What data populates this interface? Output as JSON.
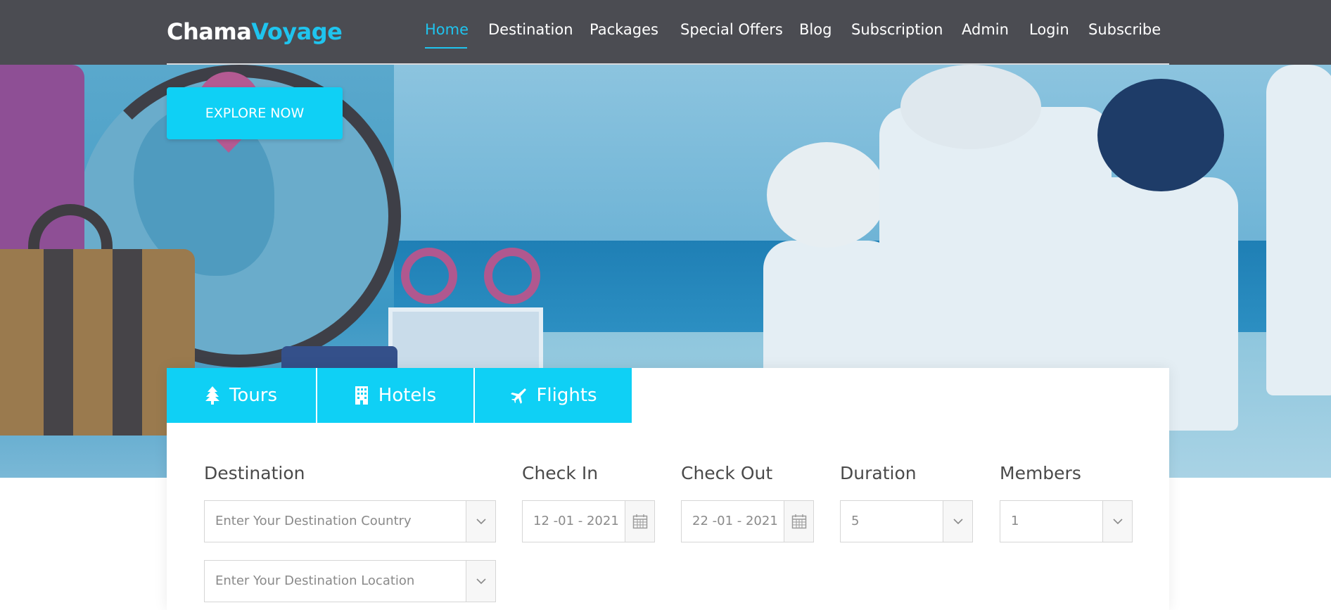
{
  "brand": {
    "name_part1": "Chama",
    "name_part2": "Voyage"
  },
  "nav": {
    "items": [
      {
        "label": "Home"
      },
      {
        "label": "Destination"
      },
      {
        "label": "Packages"
      },
      {
        "label": "Special Offers"
      },
      {
        "label": "Blog"
      },
      {
        "label": "Subscription"
      },
      {
        "label": "Admin"
      },
      {
        "label": "Login"
      },
      {
        "label": "Subscribe"
      }
    ],
    "active": "Home"
  },
  "hero": {
    "cta_label": "EXPLORE NOW"
  },
  "search": {
    "tabs": [
      {
        "label": "Tours",
        "icon": "tree-icon"
      },
      {
        "label": "Hotels",
        "icon": "building-icon"
      },
      {
        "label": "Flights",
        "icon": "plane-icon"
      }
    ],
    "destination": {
      "label": "Destination",
      "country_placeholder": "Enter Your Destination Country",
      "location_placeholder": "Enter Your Destination Location"
    },
    "check_in": {
      "label": "Check In",
      "value": "12 -01 - 2021"
    },
    "check_out": {
      "label": "Check Out",
      "value": "22 -01 - 2021"
    },
    "duration": {
      "label": "Duration",
      "value": "5"
    },
    "members": {
      "label": "Members",
      "value": "1"
    }
  },
  "colors": {
    "accent": "#0fd0f5",
    "brand_accent": "#1fc4ee",
    "topbar": "#4b4c52"
  }
}
